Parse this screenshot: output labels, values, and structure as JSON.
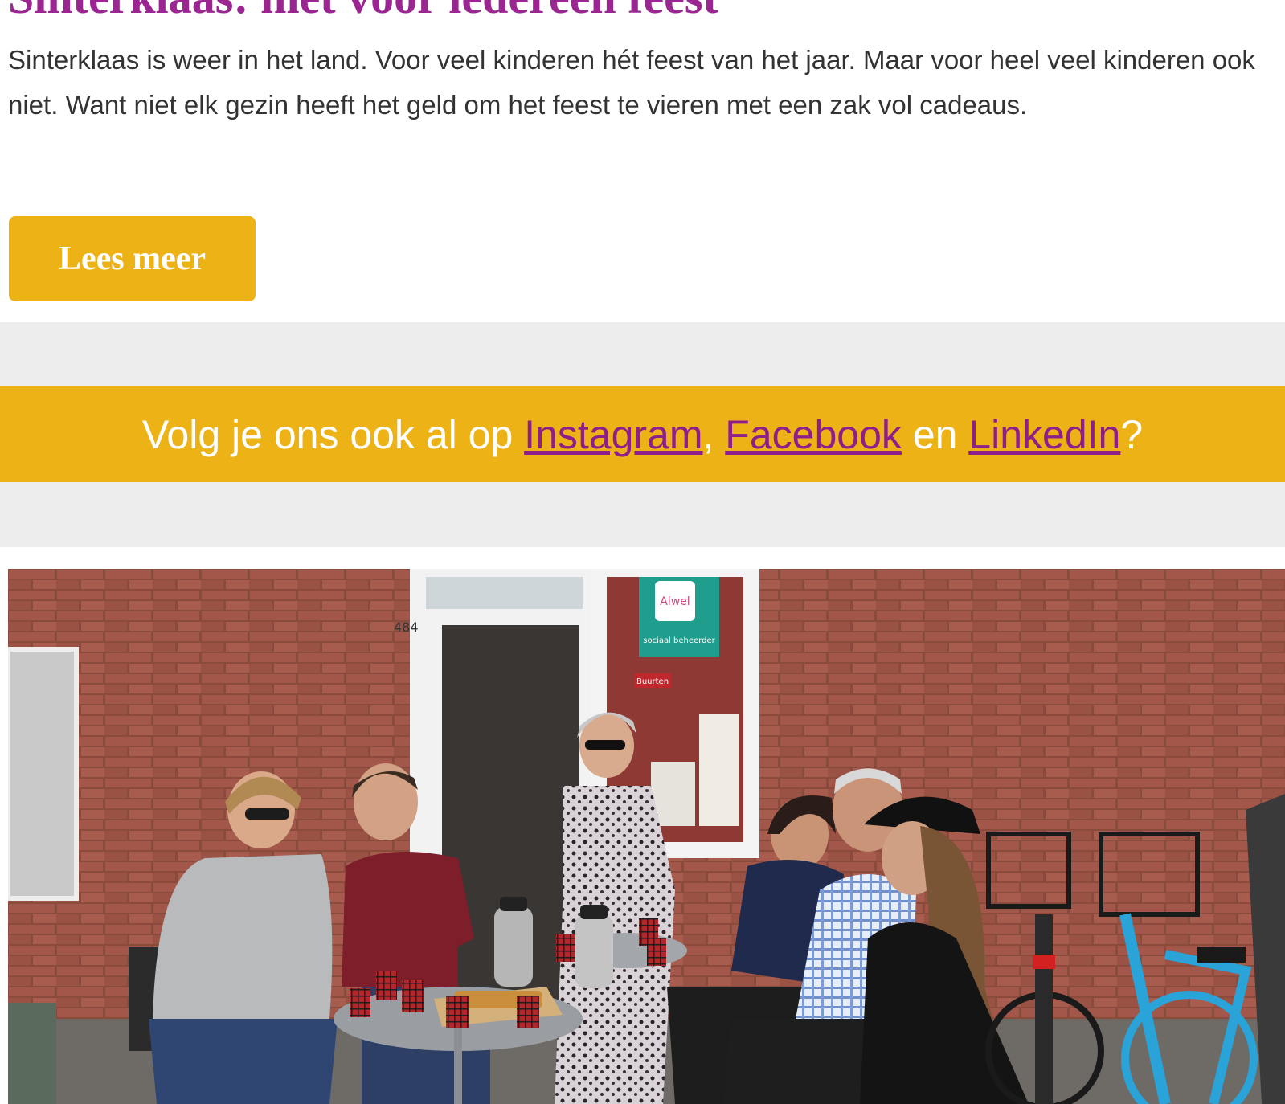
{
  "article": {
    "title": "Sinterklaas: niet voor iedereen feest",
    "intro": "Sinterklaas is weer in het land. Voor veel kinderen hét feest van het jaar. Maar voor heel veel kinderen ook niet. Want niet elk gezin heeft het geld om het feest te vieren met een zak vol cadeaus.",
    "read_more_label": "Lees meer"
  },
  "social": {
    "prefix": "Volg je ons ook al op ",
    "instagram": "Instagram",
    "sep1": ", ",
    "facebook": "Facebook",
    "sep2": " en ",
    "linkedin": "LinkedIn",
    "suffix": "?"
  },
  "photo": {
    "house_number": "484",
    "sign_brand": "Alwel",
    "sign_text": "sociaal beheerder",
    "poster_text": "Buurten"
  },
  "colors": {
    "accent_purple": "#9b2591",
    "accent_yellow": "#edb216",
    "band_gray": "#ededed",
    "text_dark": "#333333"
  }
}
